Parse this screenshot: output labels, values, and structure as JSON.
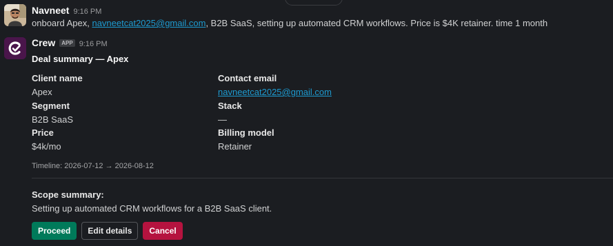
{
  "messages": [
    {
      "sender": "Navneet",
      "time": "9:16 PM",
      "text_before": "onboard Apex, ",
      "email_link": "navneetcat2025@gmail.com",
      "text_after": ", B2B SaaS, setting up automated CRM workflows. Price is $4K retainer. time 1 month"
    },
    {
      "sender": "Crew",
      "badge": "APP",
      "time": "9:16 PM",
      "title": "Deal summary — Apex",
      "fields": {
        "client_name": {
          "label": "Client name",
          "value": "Apex"
        },
        "contact_email": {
          "label": "Contact email",
          "value": "navneetcat2025@gmail.com"
        },
        "segment": {
          "label": "Segment",
          "value": "B2B SaaS"
        },
        "stack": {
          "label": "Stack",
          "value": "—"
        },
        "price": {
          "label": "Price",
          "value": "$4k/mo"
        },
        "billing_model": {
          "label": "Billing model",
          "value": "Retainer"
        }
      },
      "timeline": "Timeline: 2026-07-12 → 2026-08-12",
      "scope_label": "Scope summary:",
      "scope_text": "Setting up automated CRM workflows for a B2B SaaS client.",
      "buttons": {
        "proceed": "Proceed",
        "edit": "Edit details",
        "cancel": "Cancel"
      }
    }
  ],
  "colors": {
    "background": "#1b1d21",
    "link": "#1d9bd1",
    "proceed": "#007a5a",
    "cancel": "#b5133f",
    "crew_avatar": "#4a154b"
  },
  "icons": {
    "user_avatar": "user-photo-avatar",
    "crew_avatar": "crew-app-logo"
  }
}
